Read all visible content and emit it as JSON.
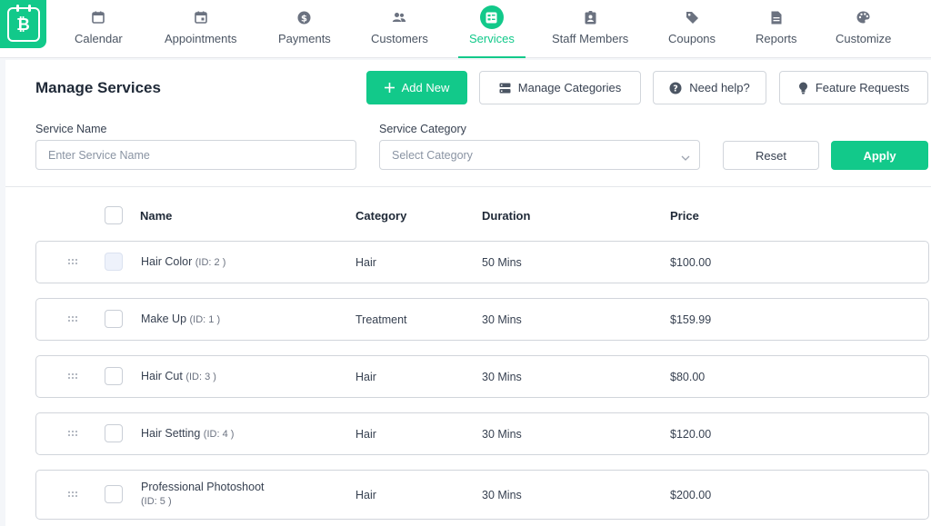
{
  "nav": {
    "items": [
      {
        "label": "Calendar",
        "icon": "calendar-icon"
      },
      {
        "label": "Appointments",
        "icon": "calendar-check-icon"
      },
      {
        "label": "Payments",
        "icon": "dollar-icon"
      },
      {
        "label": "Customers",
        "icon": "users-icon"
      },
      {
        "label": "Services",
        "icon": "services-icon",
        "active": true
      },
      {
        "label": "Staff Members",
        "icon": "staff-badge-icon"
      },
      {
        "label": "Coupons",
        "icon": "tag-icon"
      },
      {
        "label": "Reports",
        "icon": "report-icon"
      },
      {
        "label": "Customize",
        "icon": "palette-icon"
      }
    ]
  },
  "header": {
    "title": "Manage Services",
    "add_new": "Add New",
    "manage_categories": "Manage Categories",
    "need_help": "Need help?",
    "feature_requests": "Feature Requests"
  },
  "filters": {
    "service_name_label": "Service Name",
    "service_name_placeholder": "Enter Service Name",
    "service_category_label": "Service Category",
    "category_selected": "Select Category",
    "reset": "Reset",
    "apply": "Apply"
  },
  "table": {
    "headers": {
      "name": "Name",
      "category": "Category",
      "duration": "Duration",
      "price": "Price"
    },
    "rows": [
      {
        "name": "Hair Color",
        "id": "(ID: 2 )",
        "category": "Hair",
        "duration": "50 Mins",
        "price": "$100.00"
      },
      {
        "name": "Make Up",
        "id": "(ID: 1 )",
        "category": "Treatment",
        "duration": "30 Mins",
        "price": "$159.99"
      },
      {
        "name": "Hair Cut",
        "id": "(ID: 3 )",
        "category": "Hair",
        "duration": "30 Mins",
        "price": "$80.00"
      },
      {
        "name": "Hair Setting",
        "id": "(ID: 4 )",
        "category": "Hair",
        "duration": "30 Mins",
        "price": "$120.00"
      },
      {
        "name": "Professional Photoshoot",
        "id": "(ID: 5 )",
        "category": "Hair",
        "duration": "30 Mins",
        "price": "$200.00"
      }
    ]
  },
  "colors": {
    "accent": "#12c98a",
    "border": "#d1d5db",
    "text": "#1f2937"
  }
}
